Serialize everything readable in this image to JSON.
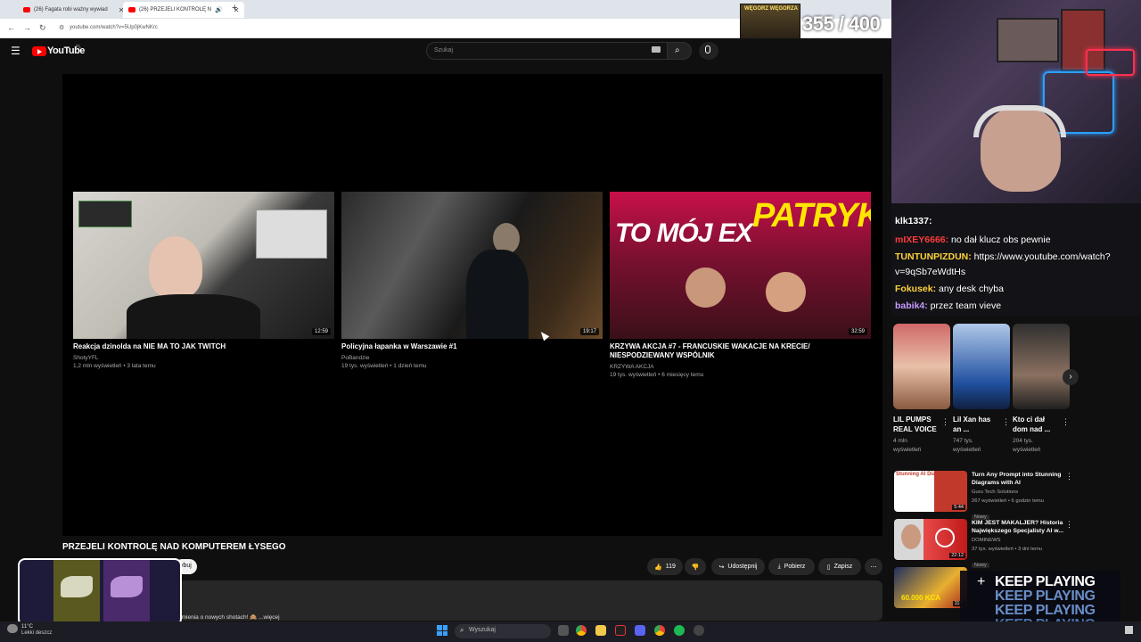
{
  "browser": {
    "tabs": [
      {
        "label": "(26) Fagata robi ważny wywiad"
      },
      {
        "label": "(26) PRZEJELI KONTROLĘ N"
      }
    ],
    "new_tab": "+",
    "url": "youtube.com/watch?v=5Up0jKwNKrc"
  },
  "youtube": {
    "logo": "YouTube",
    "logo_region": "PL",
    "search_placeholder": "Szukaj",
    "video_title": "PRZEJELI KONTROLĘ NAD KOMPUTEREM ŁYSEGO",
    "subscribe_partial": "ybuj",
    "actions": {
      "likes": "119",
      "share": "Udostępnij",
      "download": "Pobierz",
      "save": "Zapisz"
    },
    "description_snippet": "omienia o nowych shotach! 🙈 ...więcej"
  },
  "endcards": [
    {
      "title": "Reakcja dzinolda na NIE MA TO JAK TWITCH",
      "channel": "ShotyYFL",
      "meta": "1,2 mln wyświetleń • 3 lata temu",
      "duration": "12:59"
    },
    {
      "title": "Policyjna łapanka w Warszawie #1",
      "channel": "PoBandzie",
      "meta": "19 tys. wyświetleń • 1 dzień temu",
      "duration": "19:17"
    },
    {
      "title": "KRZYWA AKCJA #7 - FRANCUSKIE WAKACJE NA KRECIE/ NIESPODZIEWANY WSPÓLNIK",
      "channel": "KRZYWA AKCJA",
      "meta": "19 tys. wyświetleń • 6 miesięcy temu",
      "duration": "32:59",
      "thumb_text_1": "TO MÓJ EX",
      "thumb_text_2": "PATRYK"
    }
  ],
  "stream": {
    "counter": "355 / 400",
    "overlay_label": "WĘGORZ WĘGORZA",
    "chat": [
      {
        "user": "klk1337:",
        "color": "#ffffff",
        "text": ""
      },
      {
        "user": "mIXEY6666:",
        "color": "#ff3b3b",
        "text": " no dał klucz obs pewnie"
      },
      {
        "user": "TUNTUNPIZDUN:",
        "color": "#ffd23b",
        "text": " https://www.youtube.com/watch?"
      },
      {
        "user": "",
        "color": "#ffffff",
        "text": "v=9qSb7eWdtHs"
      },
      {
        "user": "Fokusek:",
        "color": "#ffd23b",
        "text": " any desk chyba"
      },
      {
        "user": "babik4:",
        "color": "#c89bff",
        "text": " przez team vieve"
      }
    ],
    "keep_playing": "KEEP PLAYING"
  },
  "shorts": [
    {
      "title": "LIL PUMPS REAL VOICE",
      "views": "4 mln",
      "views2": "wyświetleń"
    },
    {
      "title": "Lil Xan has an ...",
      "views": "747 tys.",
      "views2": "wyświetleń"
    },
    {
      "title": "Kto ci dał dom nad ...",
      "views": "204 tys.",
      "views2": "wyświetleń"
    }
  ],
  "recommendations": [
    {
      "title": "Turn Any Prompt into Stunning Diagrams with AI",
      "channel": "Guru Tech Solutions",
      "meta": "267 wyświetleń • 6 godzin temu",
      "badge": "Nowy",
      "duration": "5:44",
      "thumb_text": "Stunning AI Diagram"
    },
    {
      "title": "KIM JEST MAKALJER? Historia Największego Specjalisty AI w...",
      "channel": "DOMINEWS",
      "meta": "37 tys. wyświetleń • 3 dni temu",
      "badge": "Nowy",
      "duration": "22:12"
    },
    {
      "title": "",
      "channel": "",
      "meta": "",
      "badge": "",
      "duration": "11:5",
      "thumb_text": "60.000 KCA"
    }
  ],
  "taskbar": {
    "weather": "Lekki deszcz",
    "temp": "11°C",
    "search": "Wyszukaj"
  },
  "colors": {
    "youtube_red": "#ff0000",
    "bg": "#0f0f0f"
  }
}
